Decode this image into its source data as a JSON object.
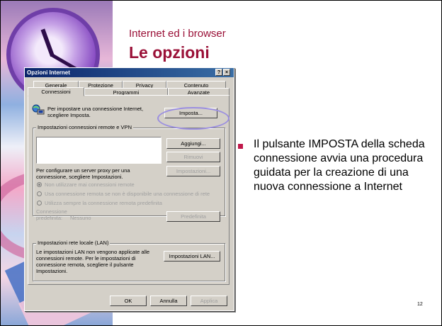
{
  "slide": {
    "subtitle": "Internet ed i browser",
    "title": "Le opzioni",
    "bullet": "Il pulsante IMPOSTA della scheda connessione avvia una procedura guidata per la creazione di una nuova connessione a Internet",
    "page_number": "12",
    "colors": {
      "title": "#9a1037",
      "bullet": "#c0184a",
      "highlight_oval": "#9b8fe0"
    }
  },
  "dialog": {
    "title": "Opzioni Internet",
    "titlebar_buttons": [
      "?",
      "×"
    ],
    "tabs_back": [
      "Generale",
      "Protezione",
      "Privacy",
      "Contenuto"
    ],
    "tabs_front": [
      "Connessioni",
      "Programmi",
      "Avanzate"
    ],
    "setup_text": "Per impostare una connessione Internet, scegliere Imposta.",
    "setup_button": "Imposta...",
    "dialup_group_label": "Impostazioni connessioni remote e VPN",
    "add_button": "Aggiungi...",
    "remove_button": "Rimuovi",
    "proxy_text": "Per configurare un server proxy per una connessione, scegliere Impostazioni.",
    "settings_button": "Impostazioni...",
    "radio_options": [
      "Non utilizzare mai connessioni remote",
      "Usa connessione remota se non è disponibile una connessione di rete",
      "Utilizza sempre la connessione remota predefinita"
    ],
    "default_label": "Connessione predefinita:",
    "default_value": "Nessuno",
    "default_button": "Predefinita",
    "lan_group_label": "Impostazioni rete locale (LAN)",
    "lan_text": "Le impostazioni LAN non vengono applicate alle connessioni remote. Per le impostazioni di connessione remota, scegliere il pulsante Impostazioni.",
    "lan_button": "Impostazioni LAN...",
    "ok_button": "OK",
    "cancel_button": "Annulla",
    "apply_button": "Applica"
  }
}
